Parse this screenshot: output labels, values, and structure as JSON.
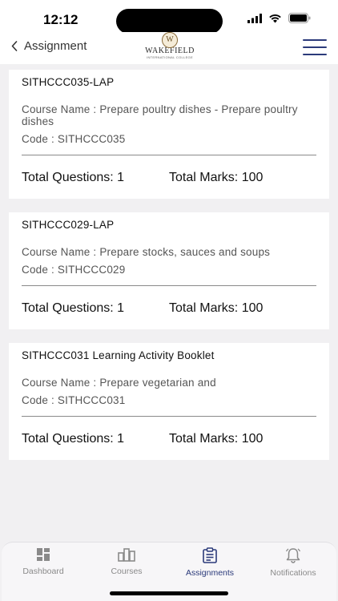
{
  "status": {
    "time": "12:12"
  },
  "header": {
    "back_label": "Assignment",
    "logo_name": "WAKEFIELD",
    "logo_sub": "INTERNATIONAL COLLEGE",
    "logo_crest_letter": "W"
  },
  "assignments": [
    {
      "title": "SITHCCC035-LAP",
      "course": "Course Name : Prepare poultry dishes - Prepare poultry dishes",
      "code": "Code : SITHCCC035",
      "questions": "Total Questions: 1",
      "marks": "Total Marks: 100"
    },
    {
      "title": "SITHCCC029-LAP",
      "course": "Course Name : Prepare stocks, sauces and soups",
      "code": "Code : SITHCCC029",
      "questions": "Total Questions: 1",
      "marks": "Total Marks: 100"
    },
    {
      "title": "SITHCCC031 Learning Activity Booklet",
      "course": "Course Name : Prepare vegetarian and",
      "code": "Code : SITHCCC031",
      "questions": "Total Questions: 1",
      "marks": "Total Marks: 100"
    }
  ],
  "tabs": [
    {
      "label": "Dashboard",
      "icon": "dashboard-icon",
      "active": false
    },
    {
      "label": "Courses",
      "icon": "courses-icon",
      "active": false
    },
    {
      "label": "Assignments",
      "icon": "assignments-icon",
      "active": true
    },
    {
      "label": "Notifications",
      "icon": "bell-icon",
      "active": false
    }
  ],
  "colors": {
    "accent": "#2b3a7a",
    "inactive": "#8a8a8a",
    "background": "#f1f0f2"
  }
}
